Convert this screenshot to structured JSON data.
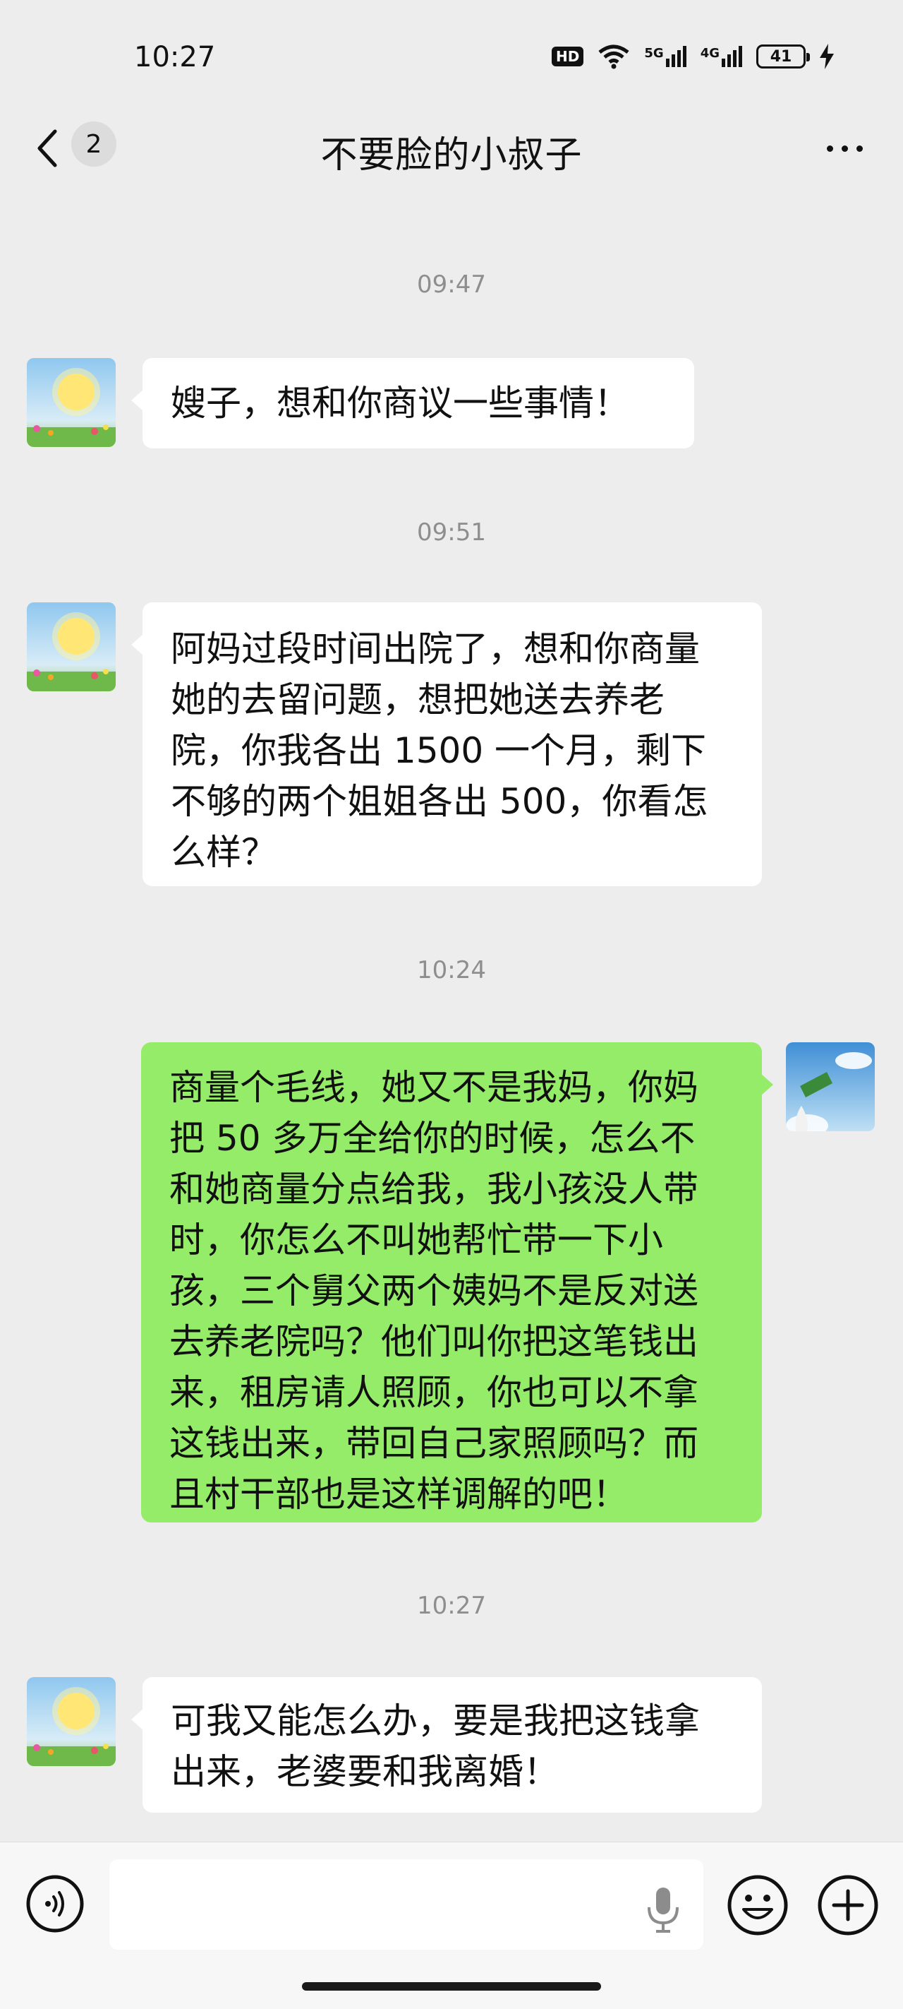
{
  "status_bar": {
    "time": "10:27",
    "hd_label": "HD",
    "network_1": "5G",
    "network_2": "4G",
    "battery": "41"
  },
  "nav": {
    "unread_count": "2",
    "title": "不要脸的小叔子"
  },
  "messages": [
    {
      "time": "09:47",
      "side": "left",
      "text": "嫂子，想和你商议一些事情！"
    },
    {
      "time": "09:51",
      "side": "left",
      "text": "阿妈过段时间出院了，想和你商量\n她的去留问题，想把她送去养老\n院，你我各出 1500 一个月，剩下\n不够的两个姐姐各出 500，你看怎\n么样？"
    },
    {
      "time": "10:24",
      "side": "right",
      "text": "商量个毛线，她又不是我妈，你妈\n把 50 多万全给你的时候，怎么不\n和她商量分点给我，我小孩没人带\n时，你怎么不叫她帮忙带一下小\n孩，三个舅父两个姨妈不是反对送\n去养老院吗？他们叫你把这笔钱出\n来，租房请人照顾，你也可以不拿\n这钱出来，带回自己家照顾吗？而\n且村干部也是这样调解的吧！"
    },
    {
      "time": "10:27",
      "side": "left",
      "text": "可我又能怎么办，要是我把这钱拿\n出来，老婆要和我离婚！"
    }
  ],
  "colors": {
    "background": "#ededed",
    "sent_bubble": "#95ec69",
    "received_bubble": "#ffffff"
  },
  "icons": [
    "back-arrow-icon",
    "more-dots-icon",
    "wifi-icon",
    "signal-icon",
    "battery-icon",
    "charging-icon",
    "voice-icon",
    "mic-icon",
    "emoji-icon",
    "plus-icon"
  ]
}
